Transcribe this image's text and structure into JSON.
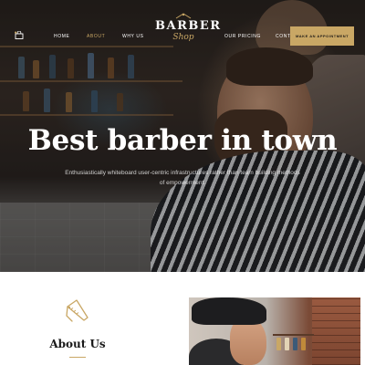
{
  "nav": {
    "items": [
      {
        "label": "HOME",
        "active": false
      },
      {
        "label": "ABOUT",
        "active": true
      },
      {
        "label": "WHY US",
        "active": false
      },
      {
        "label": "OUR PRICING",
        "active": false
      },
      {
        "label": "CONTA",
        "active": false
      }
    ],
    "cart_icon": "shopping-bag-icon",
    "appointment_label": "MAKE AN APPOINTMENT"
  },
  "logo": {
    "line1": "BARBER",
    "line2": "Shop"
  },
  "hero": {
    "title": "Best barber in town",
    "subtitle": "Enthusiastically whiteboard user-centric infrastructures rather than team building methods of empowerment."
  },
  "about": {
    "icon": "straight-razor-icon",
    "title": "About Us"
  },
  "colors": {
    "accent": "#c9a765",
    "hero_text": "#ffffff",
    "heading_text": "#1a1a1a"
  }
}
